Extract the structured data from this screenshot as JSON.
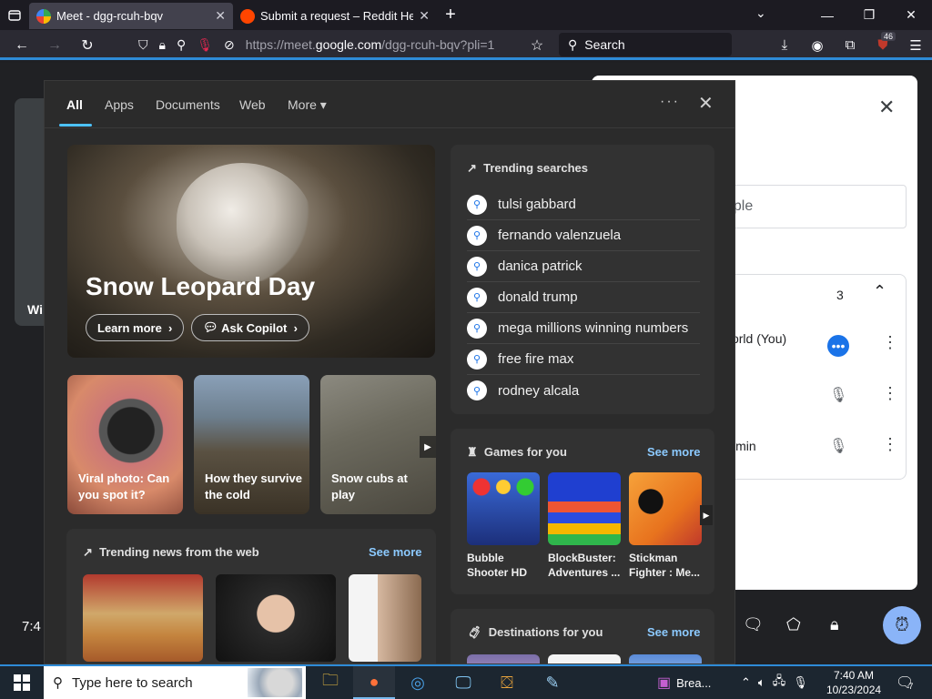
{
  "browser": {
    "tabs": [
      {
        "title": "Meet - dgg-rcuh-bqv",
        "active": true
      },
      {
        "title": "Submit a request – Reddit Help",
        "active": false
      }
    ],
    "url_host": "https://meet.",
    "url_domain": "google.com",
    "url_path": "/dgg-rcuh-bqv?pli=1",
    "search_placeholder": "Search",
    "extension_badge": "46"
  },
  "meet": {
    "left_label": "Wi",
    "time": "7:4",
    "people_search_placeholder": "ople",
    "participant_count": "3",
    "participants": [
      "World (You)",
      "",
      "Admin"
    ]
  },
  "search_flyout": {
    "tabs": [
      "All",
      "Apps",
      "Documents",
      "Web",
      "More"
    ],
    "hero": {
      "title": "Snow Leopard Day",
      "learn_more": "Learn more",
      "ask_copilot": "Ask Copilot"
    },
    "cards": [
      "Viral photo: Can you spot it?",
      "How they survive the cold",
      "Snow cubs at play"
    ],
    "trending_title": "Trending searches",
    "trending": [
      "tulsi gabbard",
      "fernando valenzuela",
      "danica patrick",
      "donald trump",
      "mega millions winning numbers",
      "free fire max",
      "rodney alcala"
    ],
    "games_title": "Games for you",
    "games": [
      "Bubble Shooter HD",
      "BlockBuster: Adventures ...",
      "Stickman Fighter : Me..."
    ],
    "news_title": "Trending news from the web",
    "dest_title": "Destinations for you",
    "see_more": "See more"
  },
  "taskbar": {
    "search_placeholder": "Type here to search",
    "teams_label": "Brea...",
    "time": "7:40 AM",
    "date": "10/23/2024",
    "notifications": "7"
  }
}
